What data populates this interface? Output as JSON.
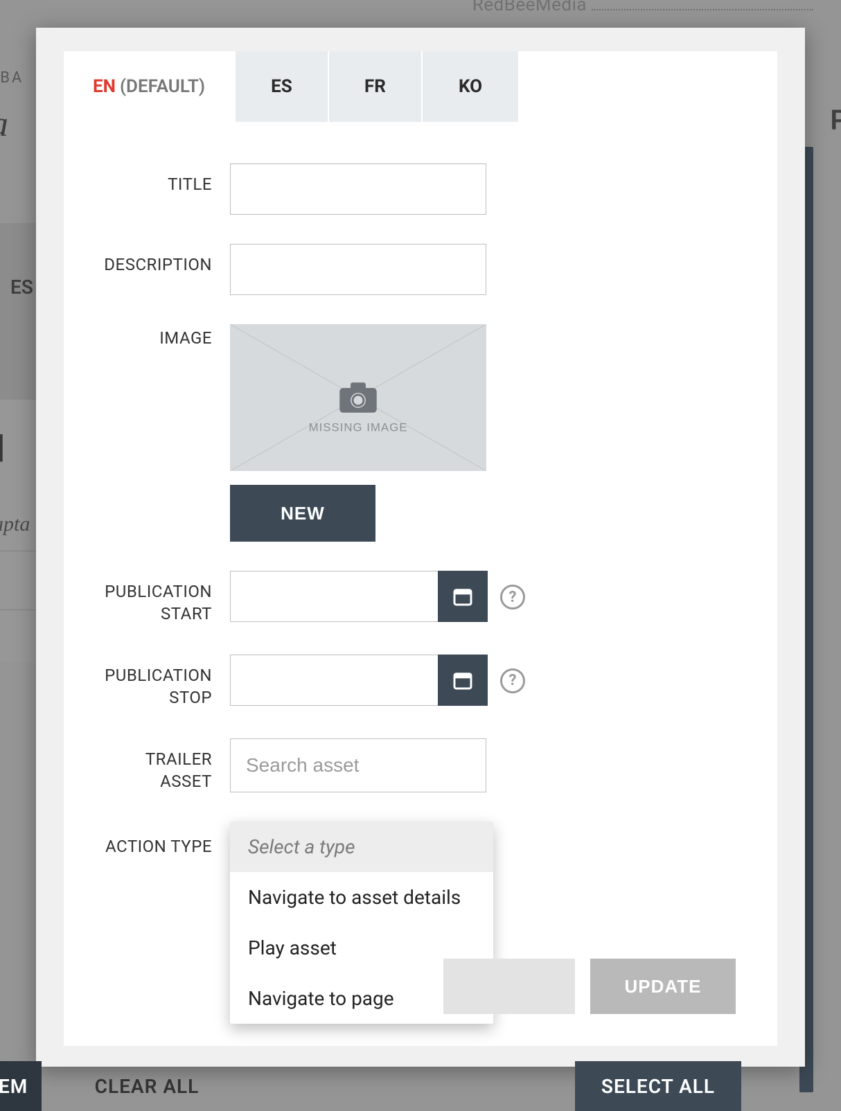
{
  "bg": {
    "top_right": "RedBeeMedia",
    "left_small": "EROBA",
    "left_es": "ES",
    "left_bracket": "]",
    "left_capt": "Capta",
    "left_paren": ")",
    "right_p": "P",
    "big_italic": "oa"
  },
  "tabs": {
    "en": "EN",
    "en_default": "(DEFAULT)",
    "es": "ES",
    "fr": "FR",
    "ko": "KO"
  },
  "form": {
    "title_label": "TITLE",
    "description_label": "DESCRIPTION",
    "image_label": "IMAGE",
    "missing_image": "MISSING IMAGE",
    "new_button": "NEW",
    "pub_start_label": "PUBLICATION START",
    "pub_stop_label": "PUBLICATION STOP",
    "trailer_label": "TRAILER ASSET",
    "trailer_placeholder": "Search asset",
    "action_type_label": "ACTION TYPE",
    "help": "?"
  },
  "dropdown": {
    "placeholder": "Select a type",
    "opt1": "Navigate to asset details",
    "opt2": "Play asset",
    "opt3": "Navigate to page"
  },
  "footer": {
    "update": "UPDATE"
  },
  "bottom": {
    "tem": "TEM",
    "clear": "CLEAR ALL",
    "select": "SELECT ALL"
  }
}
